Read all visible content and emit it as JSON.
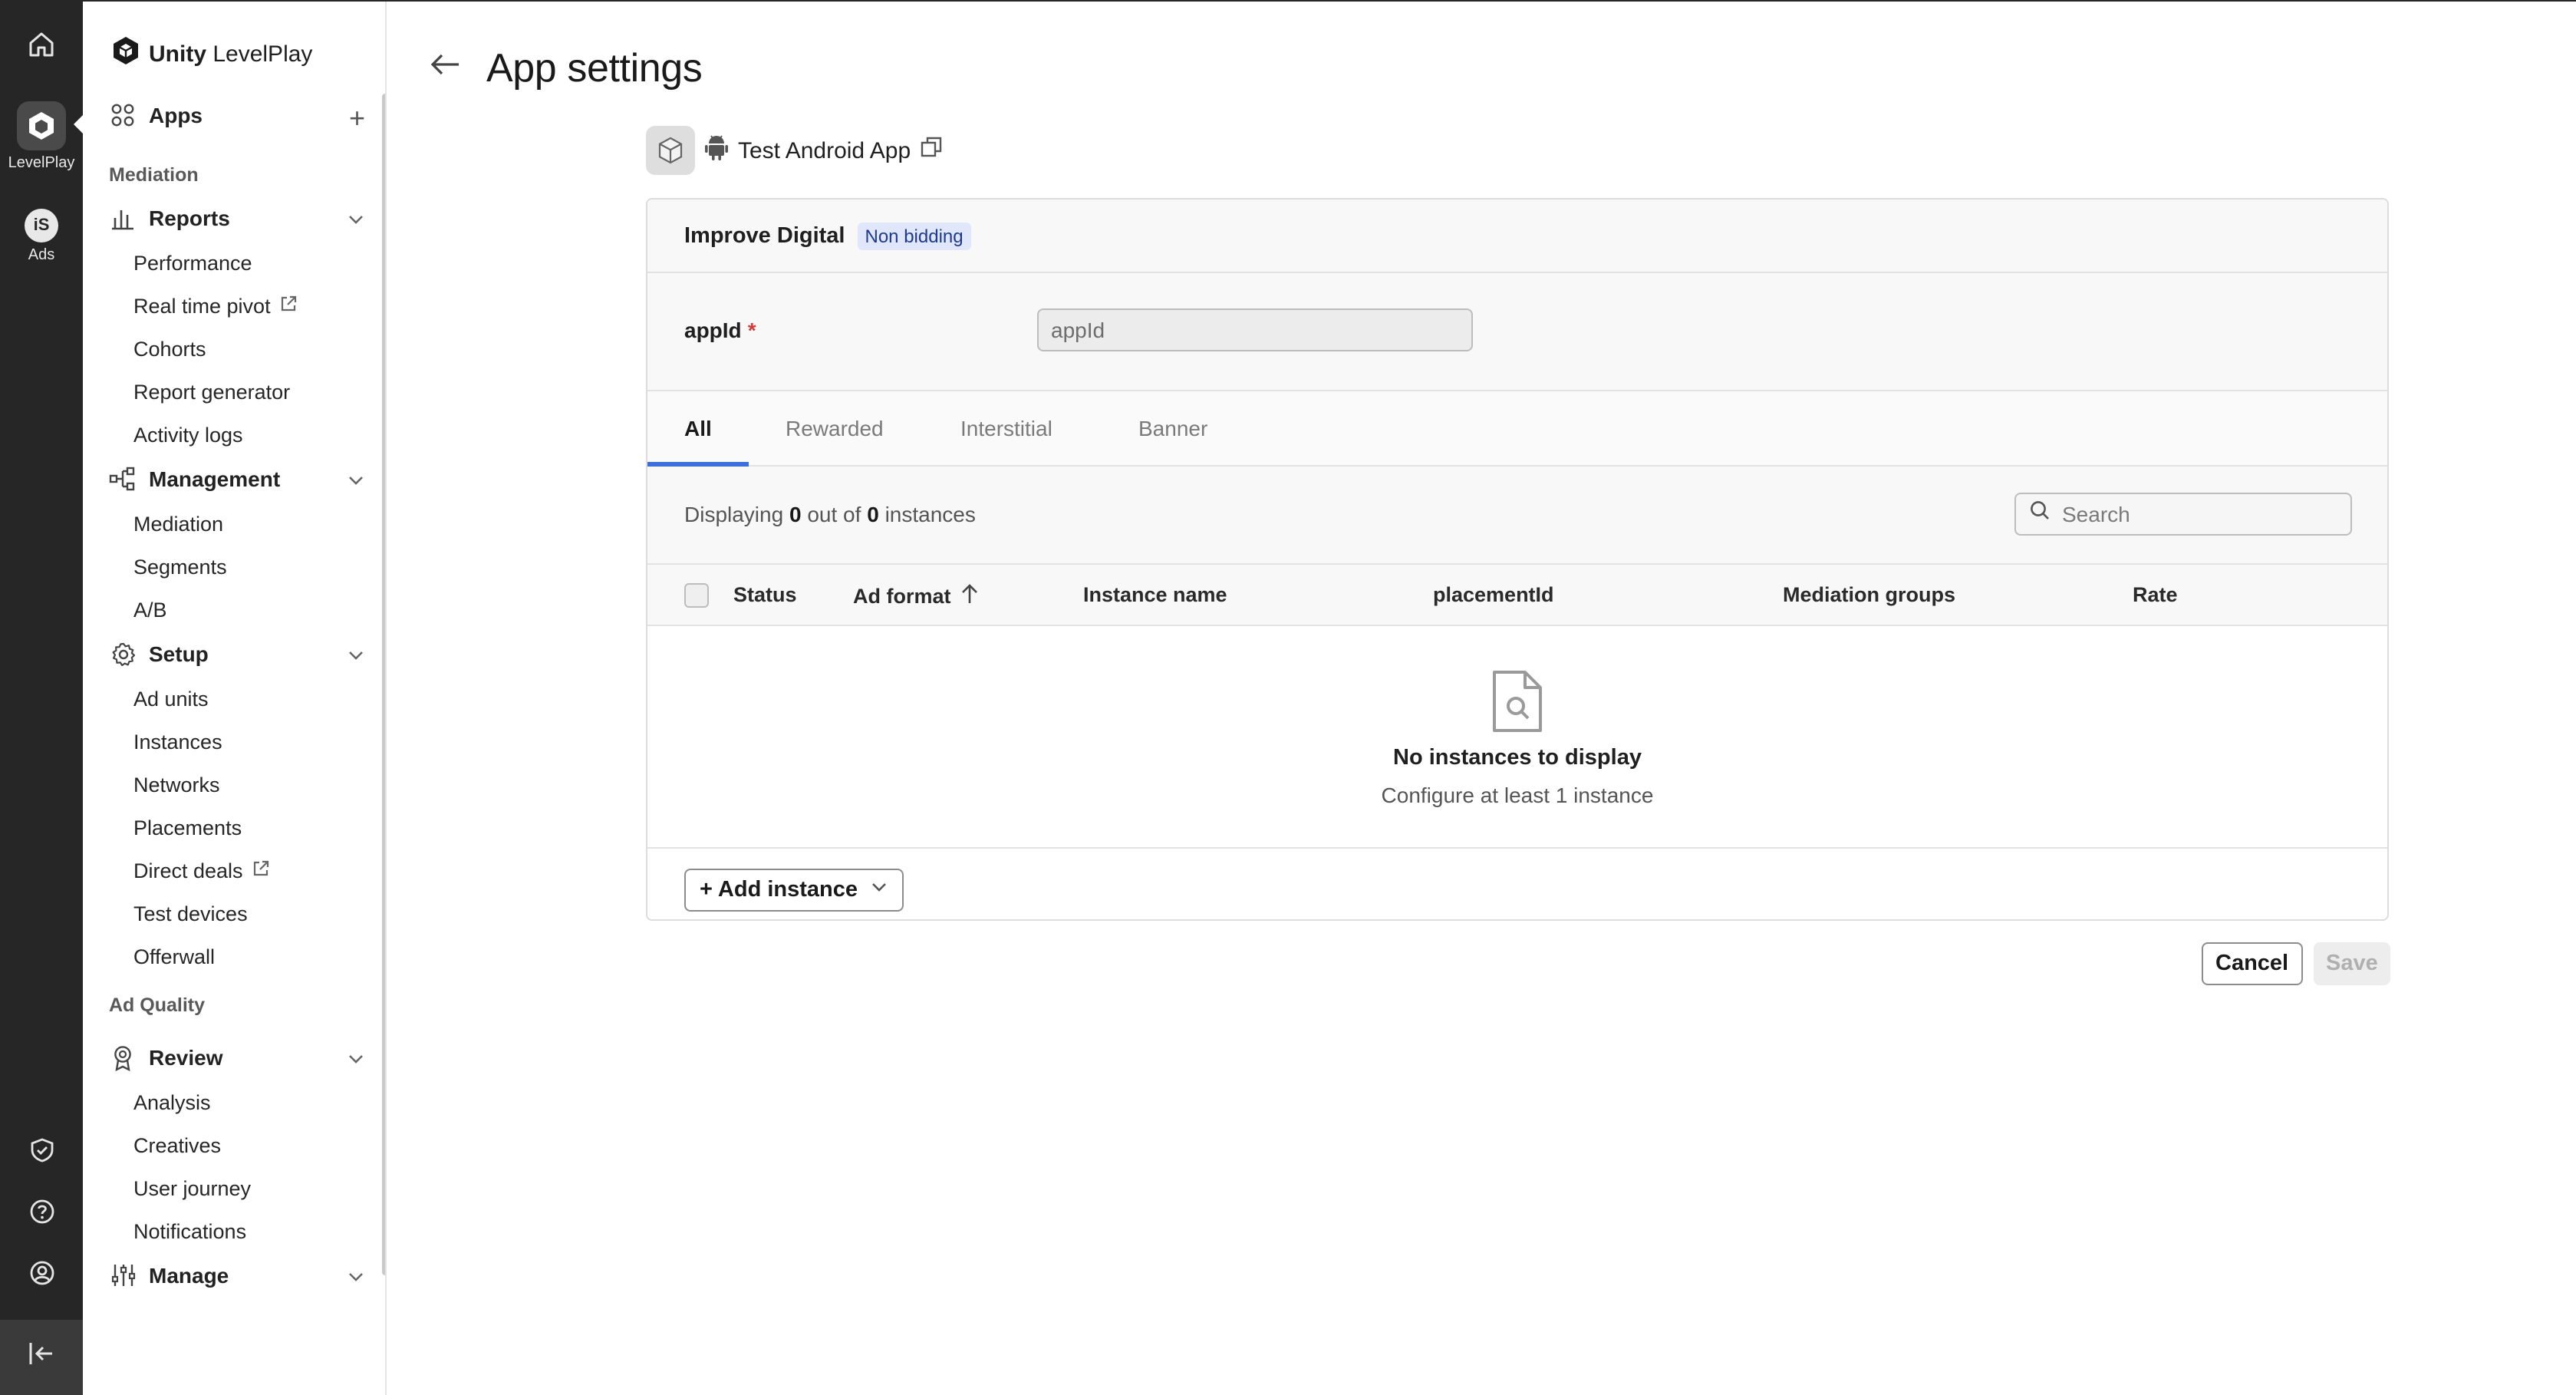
{
  "rail": {
    "items": [
      {
        "icon": "home-icon",
        "label": ""
      },
      {
        "icon": "levelplay-icon",
        "label": "LevelPlay"
      },
      {
        "icon": "ads-icon",
        "label": "Ads",
        "glyph": "iS"
      }
    ],
    "bottom": [
      "shield-check-icon",
      "help-icon",
      "account-icon",
      "collapse-sidebar-icon"
    ]
  },
  "brand": {
    "bold": "Unity",
    "rest": " LevelPlay"
  },
  "sidebar": {
    "apps": "Apps",
    "sections": {
      "mediation": "Mediation",
      "ad_quality": "Ad Quality"
    },
    "reports": {
      "label": "Reports",
      "items": [
        "Performance",
        "Real time pivot",
        "Cohorts",
        "Report generator",
        "Activity logs"
      ]
    },
    "management": {
      "label": "Management",
      "items": [
        "Mediation",
        "Segments",
        "A/B"
      ]
    },
    "setup": {
      "label": "Setup",
      "items": [
        "Ad units",
        "Instances",
        "Networks",
        "Placements",
        "Direct deals",
        "Test devices",
        "Offerwall"
      ]
    },
    "review": {
      "label": "Review",
      "items": [
        "Analysis",
        "Creatives",
        "User journey",
        "Notifications"
      ]
    },
    "manage": {
      "label": "Manage"
    }
  },
  "page": {
    "title": "App settings",
    "app_name": "Test Android App"
  },
  "network": {
    "name": "Improve Digital",
    "badge": "Non bidding",
    "field_label": "appId",
    "field_placeholder": "appId"
  },
  "tabs": [
    "All",
    "Rewarded",
    "Interstitial",
    "Banner"
  ],
  "listing": {
    "prefix": "Displaying",
    "shown": "0",
    "middle": "out of",
    "total": "0",
    "suffix": "instances",
    "search_placeholder": "Search"
  },
  "table": {
    "columns": [
      "Status",
      "Ad format",
      "Instance name",
      "placementId",
      "Mediation groups",
      "Rate"
    ]
  },
  "empty": {
    "title": "No instances to display",
    "subtitle": "Configure at least 1 instance"
  },
  "actions": {
    "add_instance": "+ Add instance",
    "cancel": "Cancel",
    "save": "Save"
  },
  "colors": {
    "rail_bg": "#262626",
    "accent": "#3b6fd9",
    "badge_bg": "#e1e7fa",
    "required": "#d23b3b"
  }
}
